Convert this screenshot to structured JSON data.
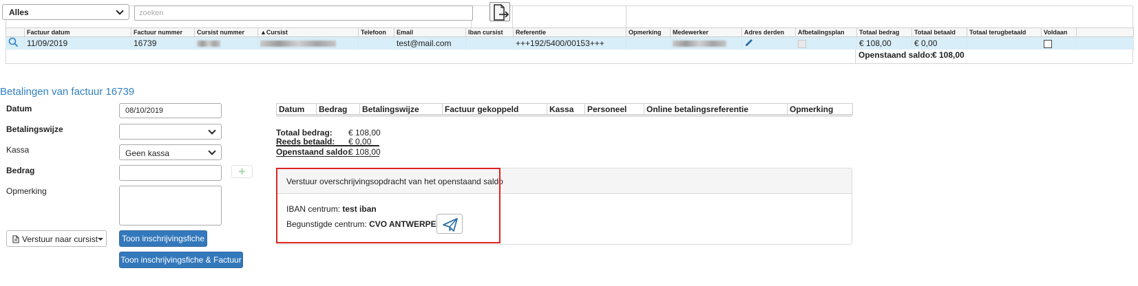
{
  "filter": {
    "select_value": "Alles",
    "search_placeholder": "zoeken"
  },
  "invoice_table": {
    "columns": [
      "",
      "Factuur datum",
      "Factuur nummer",
      "Cursist nummer",
      "▲Cursist",
      "Telefoon",
      "Email",
      "Iban cursist",
      "Referentie",
      "Opmerking",
      "Medewerker",
      "Adres derden",
      "Afbetalingsplan",
      "Totaal bedrag",
      "Totaal betaald",
      "Totaal terugbetaald",
      "Voldaan",
      ""
    ],
    "row": {
      "factuur_datum": "11/09/2019",
      "factuur_nummer": "16739",
      "email": "test@mail.com",
      "referentie": "+++192/5400/00153+++",
      "totaal_bedrag": "€ 108,00",
      "totaal_betaald": "€ 0,00"
    },
    "summary": {
      "label": "Openstaand saldo:",
      "value": "€ 108,00"
    }
  },
  "payments": {
    "title": "Betalingen van factuur 16739",
    "form": {
      "datum_label": "Datum",
      "datum_value": "08/10/2019",
      "betalingswijze_label": "Betalingswijze",
      "betalingswijze_value": "",
      "kassa_label": "Kassa",
      "kassa_value": "Geen kassa",
      "bedrag_label": "Bedrag",
      "bedrag_value": "",
      "opmerking_label": "Opmerking",
      "opmerking_value": ""
    },
    "buttons": {
      "verstuur": "Verstuur naar cursist",
      "toon_fiche": "Toon inschrijvingsfiche",
      "toon_fiche_factuur": "Toon inschrijvingsfiche & Factuur"
    },
    "table_columns": [
      "Datum",
      "Bedrag",
      "Betalingswijze",
      "Factuur gekoppeld",
      "Kassa",
      "Personeel",
      "Online betalingsreferentie",
      "Opmerking"
    ],
    "totals": {
      "totaal_label": "Totaal bedrag:",
      "totaal_value": "€ 108,00",
      "betaald_label": "Reeds betaald:",
      "betaald_value": "€ 0,00",
      "saldo_label": "Openstaand saldo:",
      "saldo_value": "€ 108,00"
    },
    "transfer": {
      "heading": "Verstuur overschrijvingsopdracht van het openstaand saldo",
      "iban_label": "IBAN centrum:",
      "iban_value": "test iban",
      "begunstigde_label": "Begunstigde centrum:",
      "begunstigde_value": "CVO ANTWERPEN"
    }
  },
  "colors": {
    "accent_blue": "#3378bb",
    "title_blue": "#2f7fc1",
    "row_highlight": "#d8eef9",
    "highlight_border": "#dd2222"
  }
}
